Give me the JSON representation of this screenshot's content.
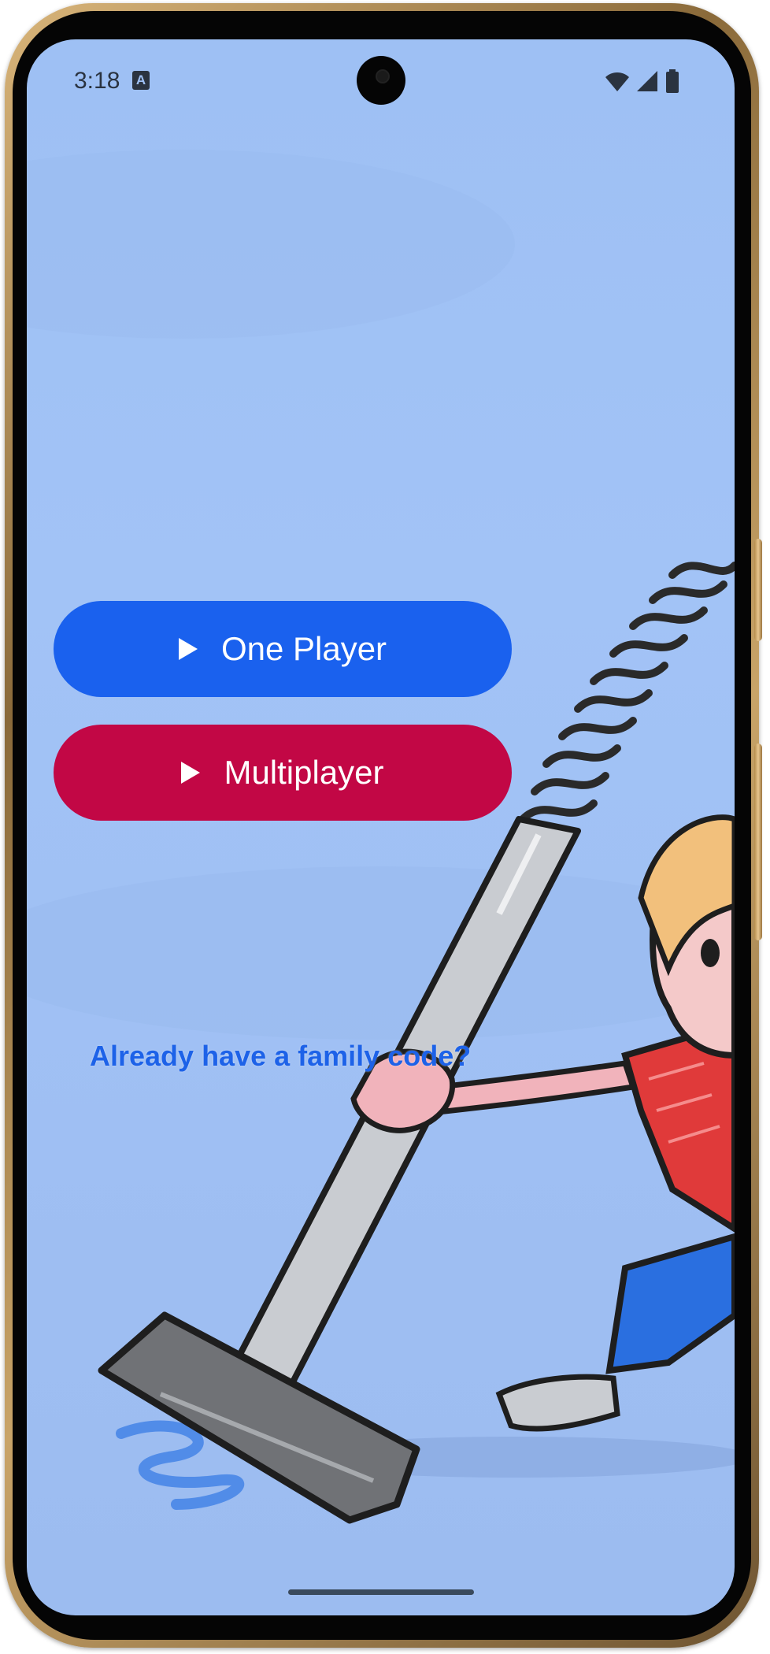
{
  "statusbar": {
    "time": "3:18",
    "notification_icon": "A",
    "icons": [
      "wifi-icon",
      "cellular-signal-icon",
      "battery-icon"
    ]
  },
  "menu": {
    "one_player_label": "One Player",
    "multiplayer_label": "Multiplayer",
    "family_code_link": "Already have a family code?"
  },
  "colors": {
    "background": "#9ec0f4",
    "one_player_button": "#1a61ee",
    "multiplayer_button": "#c20745",
    "link": "#1d62e8"
  },
  "illustration": "vacuum-cleaner-boy-illustration"
}
